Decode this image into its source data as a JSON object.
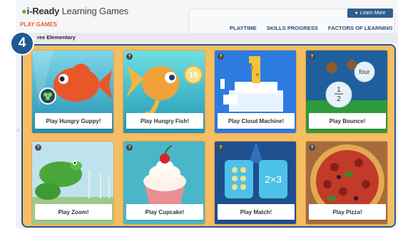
{
  "header": {
    "logo_prefix": "i-Ready",
    "logo_suffix": "Learning Games",
    "section": "PLAY GAMES",
    "learn_more": "Learn More",
    "nav": [
      "PLAYTIME",
      "SKILLS PROGRESS",
      "FACTORS OF LEARNING"
    ],
    "school": "ree Elementary"
  },
  "step_badge": "4",
  "games": [
    {
      "label": "Play Hungry Guppy!",
      "help": "?",
      "art": "fish-orange-underwater",
      "accent": "#e8572a"
    },
    {
      "label": "Play Hungry Fish!",
      "help": "?",
      "art": "goldfish-with-10-bubble",
      "accent": "#f2a23a"
    },
    {
      "label": "Play Cloud Machine!",
      "help": "?",
      "art": "giraffe-on-clouds",
      "accent": "#2b6fd6"
    },
    {
      "label": "Play Bounce!",
      "help": "?",
      "art": "monkeys-with-fraction-balloon",
      "accent": "#1f5f9e"
    },
    {
      "label": "Play Zoom!",
      "help": "?",
      "art": "frog-near-windmills",
      "accent": "#4aa63a"
    },
    {
      "label": "Play Cupcake!",
      "help": "?",
      "art": "cupcake-with-cherry",
      "accent": "#49b7c7"
    },
    {
      "label": "Play Match!",
      "help": "?",
      "art": "match-cards-2x3",
      "accent": "#1e4f8f"
    },
    {
      "label": "Play Pizza!",
      "help": "?",
      "art": "pepperoni-pizza",
      "accent": "#c23a2a"
    }
  ],
  "tile_bubble_text": {
    "hungry_fish": "10",
    "match": "2×3",
    "bounce_top": "four",
    "bounce_num": "1",
    "bounce_den": "2"
  }
}
